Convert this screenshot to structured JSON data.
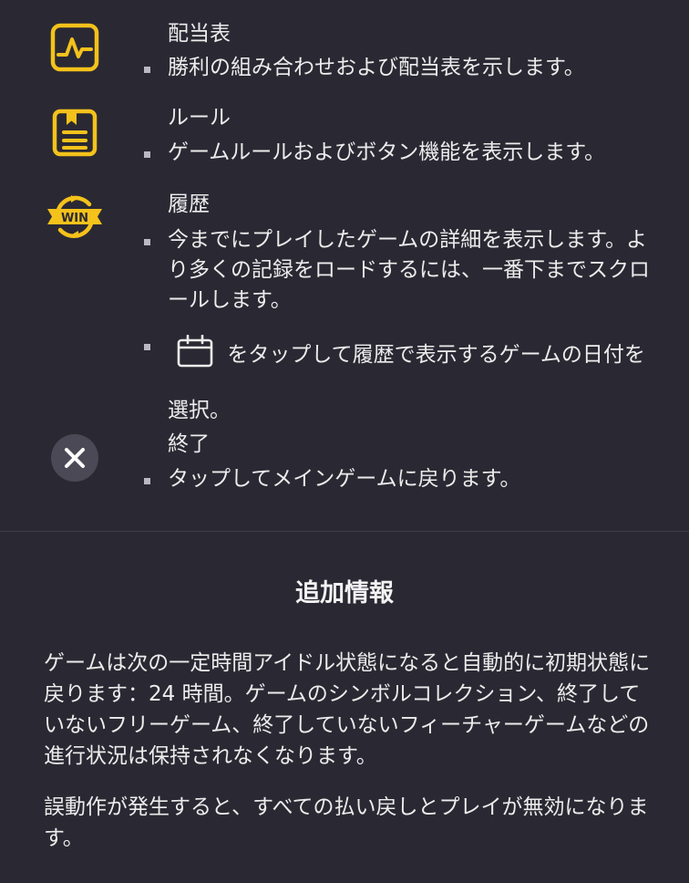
{
  "menu": {
    "paytable": {
      "icon": "paytable-chart-icon",
      "title": "配当表",
      "description": "勝利の組み合わせおよび配当表を示します。"
    },
    "rules": {
      "icon": "rules-document-icon",
      "title": "ルール",
      "description": "ゲームルールおよびボタン機能を表示します。"
    },
    "history": {
      "icon": "win-history-icon",
      "title": "履歴",
      "description": "今までにプレイしたゲームの詳細を表示します。より多くの記録をロードするには、一番下までスクロールします。",
      "date_tip_prefix": "",
      "date_tip_suffix": "をタップして履歴で表示するゲームの日付を選択。",
      "date_icon": "calendar-icon"
    },
    "exit": {
      "icon": "close-icon",
      "title": "終了",
      "description": "タップしてメインゲームに戻ります。"
    }
  },
  "additional_info": {
    "heading": "追加情報",
    "paragraph_1": "ゲームは次の一定時間アイドル状態になると自動的に初期状態に戻ります：24 時間。ゲームのシンボルコレクション、終了していないフリーゲーム、終了していないフィーチャーゲームなどの進行状況は保持されなくなります。",
    "paragraph_2": "誤動作が発生すると、すべての払い戻しとプレイが無効になります。"
  },
  "colors": {
    "background": "#2a2933",
    "accent_yellow": "#f4c21b",
    "text": "#ececec",
    "close_button_bg": "#4a4955"
  }
}
